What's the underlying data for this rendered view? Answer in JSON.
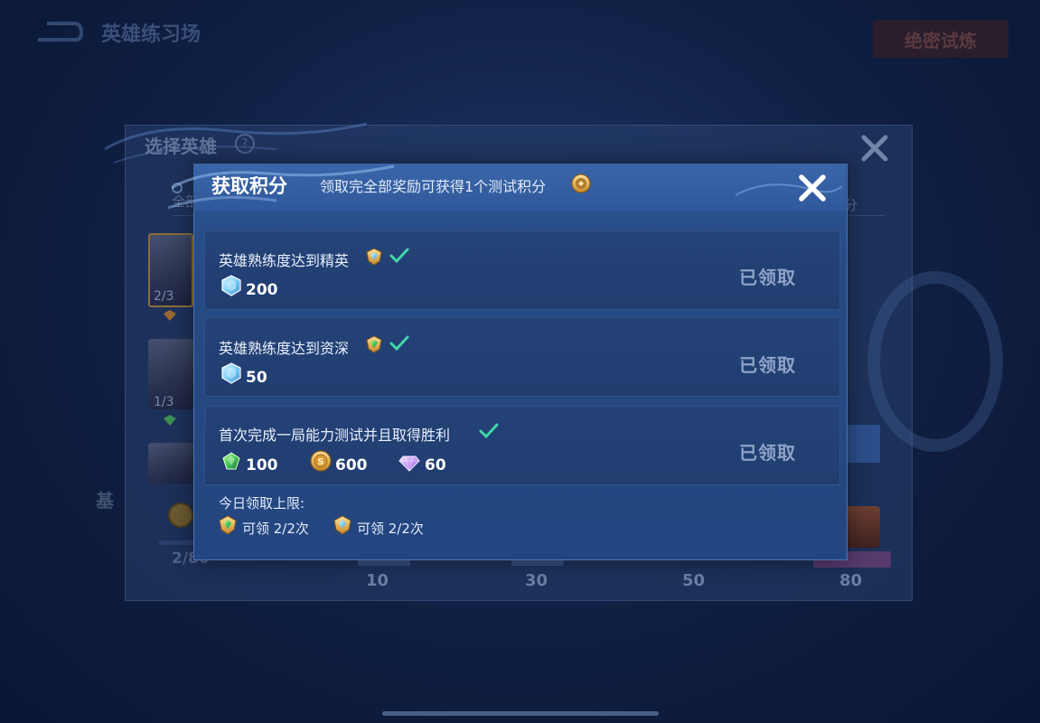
{
  "background": {
    "page_title": "英雄练习场",
    "top_button": "绝密试炼",
    "panel_title": "选择英雄",
    "tab_left": "全部",
    "tab_right": "分",
    "heroes": [
      {
        "count": "2/3"
      },
      {
        "count": "1/3"
      },
      {
        "count": ""
      }
    ],
    "side_text": "基",
    "progress_current": "2/80",
    "milestones": [
      "10",
      "30",
      "50",
      "80"
    ]
  },
  "dialog": {
    "title": "获取积分",
    "subtitle": "领取完全部奖励可获得1个测试积分",
    "tasks": [
      {
        "title": "英雄熟练度达到精英",
        "rank_icon": "elite-rank-icon",
        "rewards": [
          {
            "icon": "crystal-icon",
            "value": "200"
          }
        ],
        "status": "已领取"
      },
      {
        "title": "英雄熟练度达到资深",
        "rank_icon": "senior-rank-icon",
        "rewards": [
          {
            "icon": "crystal-icon",
            "value": "50"
          }
        ],
        "status": "已领取"
      },
      {
        "title": "首次完成一局能力测试并且取得胜利",
        "rank_icon": "",
        "rewards": [
          {
            "icon": "green-gem-icon",
            "value": "100"
          },
          {
            "icon": "gold-coin-icon",
            "value": "600"
          },
          {
            "icon": "purple-diamond-icon",
            "value": "60"
          }
        ],
        "status": "已领取"
      }
    ],
    "daily_limit": {
      "label": "今日领取上限:",
      "items": [
        {
          "icon": "senior-rank-icon",
          "text": "可领 2/2次"
        },
        {
          "icon": "elite-rank-icon",
          "text": "可领 2/2次"
        }
      ]
    }
  },
  "colors": {
    "check": "#3fd6a8",
    "claimed_text": "#8ea3c5",
    "dialog_bg": "#264a83"
  }
}
